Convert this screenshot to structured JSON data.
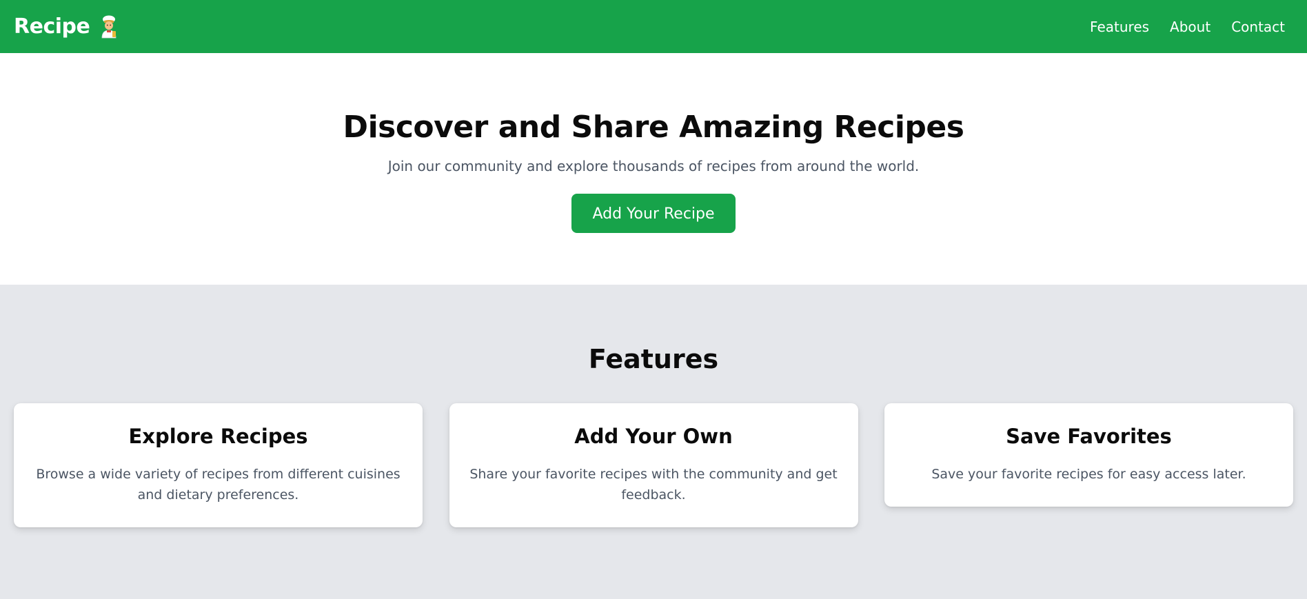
{
  "navbar": {
    "brand": "Recipe",
    "brand_icon": "chef-icon",
    "links": [
      {
        "label": "Features"
      },
      {
        "label": "About"
      },
      {
        "label": "Contact"
      }
    ],
    "background_color": "#17a34a"
  },
  "hero": {
    "title": "Discover and Share Amazing Recipes",
    "subtitle": "Join our community and explore thousands of recipes from around the world.",
    "button_label": "Add Your Recipe"
  },
  "features": {
    "title": "Features",
    "cards": [
      {
        "title": "Explore Recipes",
        "text": "Browse a wide variety of recipes from different cuisines and dietary preferences."
      },
      {
        "title": "Add Your Own",
        "text": "Share your favorite recipes with the community and get feedback."
      },
      {
        "title": "Save Favorites",
        "text": "Save your favorite recipes for easy access later."
      }
    ],
    "background_color": "#e5e7eb"
  }
}
